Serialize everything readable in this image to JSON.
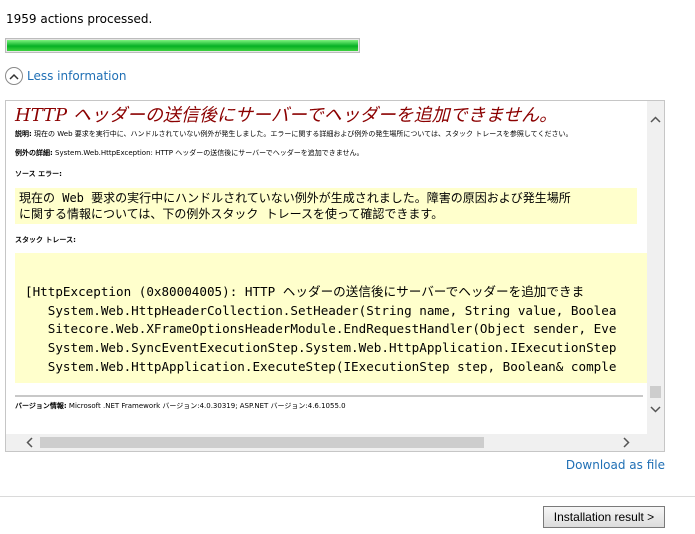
{
  "status_text": "1959 actions processed.",
  "progress_percent": 100,
  "toggle_label": "Less information",
  "error": {
    "title": "HTTP ヘッダーの送信後にサーバーでヘッダーを追加できません。",
    "description_label": "説明:",
    "description_text": "現在の Web 要求を実行中に、ハンドルされていない例外が発生しました。エラーに関する詳細および例外の発生場所については、スタック トレースを参照してください。",
    "exception_label": "例外の詳細:",
    "exception_text": "System.Web.HttpException: HTTP ヘッダーの送信後にサーバーでヘッダーを追加できません。",
    "source_label": "ソース エラー:",
    "source_lines": [
      "現在の Web 要求の実行中にハンドルされていない例外が生成されました。障害の原因および発生場所",
      "に関する情報については、下の例外スタック トレースを使って確認できます。"
    ],
    "stack_label": "スタック トレース:",
    "stack_lines": [
      "[HttpException (0x80004005): HTTP ヘッダーの送信後にサーバーでヘッダーを追加できま",
      "   System.Web.HttpHeaderCollection.SetHeader(String name, String value, Boolea",
      "   Sitecore.Web.XFrameOptionsHeaderModule.EndRequestHandler(Object sender, Eve",
      "   System.Web.SyncEventExecutionStep.System.Web.HttpApplication.IExecutionStep",
      "   System.Web.HttpApplication.ExecuteStep(IExecutionStep step, Boolean& comple"
    ],
    "version_label": "バージョン情報:",
    "version_text": "Microsoft .NET Framework バージョン:4.0.30319; ASP.NET バージョン:4.6.1055.0"
  },
  "download_label": "Download as file",
  "result_button_label": "Installation result >",
  "colors": {
    "progress_green": "#06b025",
    "link_blue": "#1f6fb5",
    "error_title": "#8b0000",
    "code_background": "#ffffcc"
  },
  "icons": {
    "toggle": "chevron-up-icon",
    "scroll_up": "chevron-up-icon",
    "scroll_down": "chevron-down-icon",
    "scroll_left": "chevron-left-icon",
    "scroll_right": "chevron-right-icon"
  }
}
